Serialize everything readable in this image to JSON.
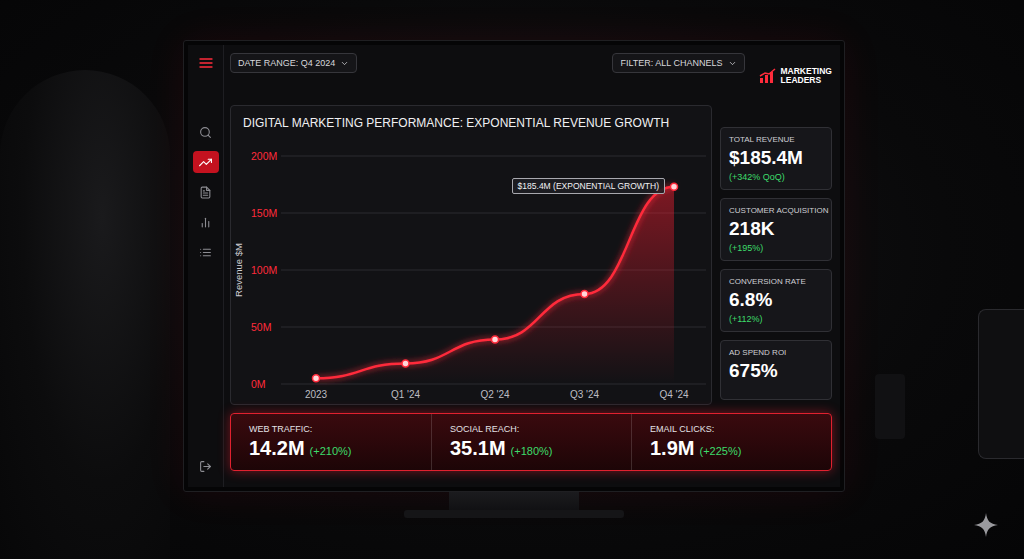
{
  "toolbar": {
    "date_range": "DATE RANGE: Q4 2024",
    "filter": "FILTER: ALL CHANNELS"
  },
  "logo": {
    "lines": [
      "MARKETING",
      "LEADERS"
    ]
  },
  "sidebar": {
    "items": [
      {
        "selected": false
      },
      {
        "selected": true
      },
      {
        "selected": false
      },
      {
        "selected": false
      },
      {
        "selected": false
      }
    ]
  },
  "chart": {
    "title": "DIGITAL MARKETING PERFORMANCE: EXPONENTIAL REVENUE GROWTH",
    "y_axis_label": "Revenue $M",
    "y_ticks": [
      "200M",
      "150M",
      "100M",
      "50M",
      "0M"
    ],
    "x_labels": [
      "2023",
      "Q1 '24",
      "Q2 '24",
      "Q3 '24",
      "Q4 '24"
    ],
    "series": [
      {
        "values": [
          5,
          18,
          39,
          79,
          173
        ]
      }
    ],
    "annotation": "$185.4M (EXPONENTIAL GROWTH)"
  },
  "kpis": [
    {
      "label": "TOTAL REVENUE",
      "value": "$185.4M",
      "change": "(+342% QoQ)"
    },
    {
      "label": "CUSTOMER ACQUISITION",
      "value": "218K",
      "change": "(+195%)"
    },
    {
      "label": "CONVERSION RATE",
      "value": "6.8%",
      "change": "(+112%)"
    },
    {
      "label": "AD SPEND ROI",
      "value": "675%"
    }
  ],
  "metrics": [
    {
      "label": "WEB TRAFFIC:",
      "value": "14.2M",
      "change": "(+210%)"
    },
    {
      "label": "SOCIAL REACH:",
      "value": "35.1M",
      "change": "(+180%)"
    },
    {
      "label": "EMAIL CLICKS:",
      "value": "1.9M",
      "change": "(+225%)"
    }
  ]
}
